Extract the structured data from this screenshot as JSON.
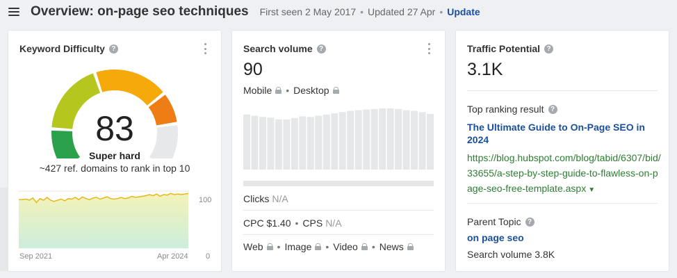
{
  "header": {
    "title": "Overview: on-page seo techniques",
    "first_seen": "First seen 2 May 2017",
    "updated": "Updated 27 Apr",
    "update_link": "Update"
  },
  "kd": {
    "title": "Keyword Difficulty",
    "value": "83",
    "label": "Super hard",
    "subtitle": "~427 ref. domains to rank in top 10",
    "gauge_fraction": 0.83,
    "chart": {
      "x_start": "Sep 2021",
      "x_end": "Apr 2024",
      "y_top": "100",
      "y_bottom": "0",
      "values": [
        85,
        85,
        86,
        84,
        88,
        80,
        87,
        84,
        89,
        84,
        82,
        84,
        86,
        83,
        87,
        86,
        89,
        85,
        90,
        87,
        85,
        88,
        89,
        86,
        88,
        90,
        87,
        86,
        87,
        89,
        87,
        88,
        91,
        89,
        90,
        91,
        92,
        94,
        92,
        95,
        91,
        94,
        93,
        96,
        94,
        95,
        94,
        95,
        96
      ]
    },
    "colors": {
      "green": "#2aa14a",
      "yellow_green": "#b5c71f",
      "orange": "#f5a90a",
      "dark_orange": "#ef7d15",
      "grey": "#e7e8ea",
      "line": "#e9b715"
    }
  },
  "sv": {
    "title": "Search volume",
    "value": "90",
    "mobile": "Mobile",
    "desktop": "Desktop",
    "bars": [
      90,
      88,
      86,
      85,
      82,
      82,
      84,
      87,
      86,
      88,
      90,
      92,
      94,
      96,
      97,
      98,
      99,
      100,
      100,
      99,
      97,
      96,
      94,
      91
    ],
    "progress": 0,
    "clicks_label": "Clicks",
    "clicks_value": "N/A",
    "cpc": "CPC $1.40",
    "cps_label": "CPS",
    "cps_value": "N/A",
    "serp_features": [
      "Web",
      "Image",
      "Video",
      "News"
    ]
  },
  "tp": {
    "title": "Traffic Potential",
    "value": "3.1K",
    "top_ranking_label": "Top ranking result",
    "top_result_title": "The Ultimate Guide to On-Page SEO in 2024",
    "top_result_url": "https://blog.hubspot.com/blog/tabid/6307/bid/33655/a-step-by-step-guide-to-flawless-on-page-seo-free-template.aspx",
    "parent_topic_label": "Parent Topic",
    "parent_topic": "on page seo",
    "parent_sv": "Search volume 3.8K"
  }
}
